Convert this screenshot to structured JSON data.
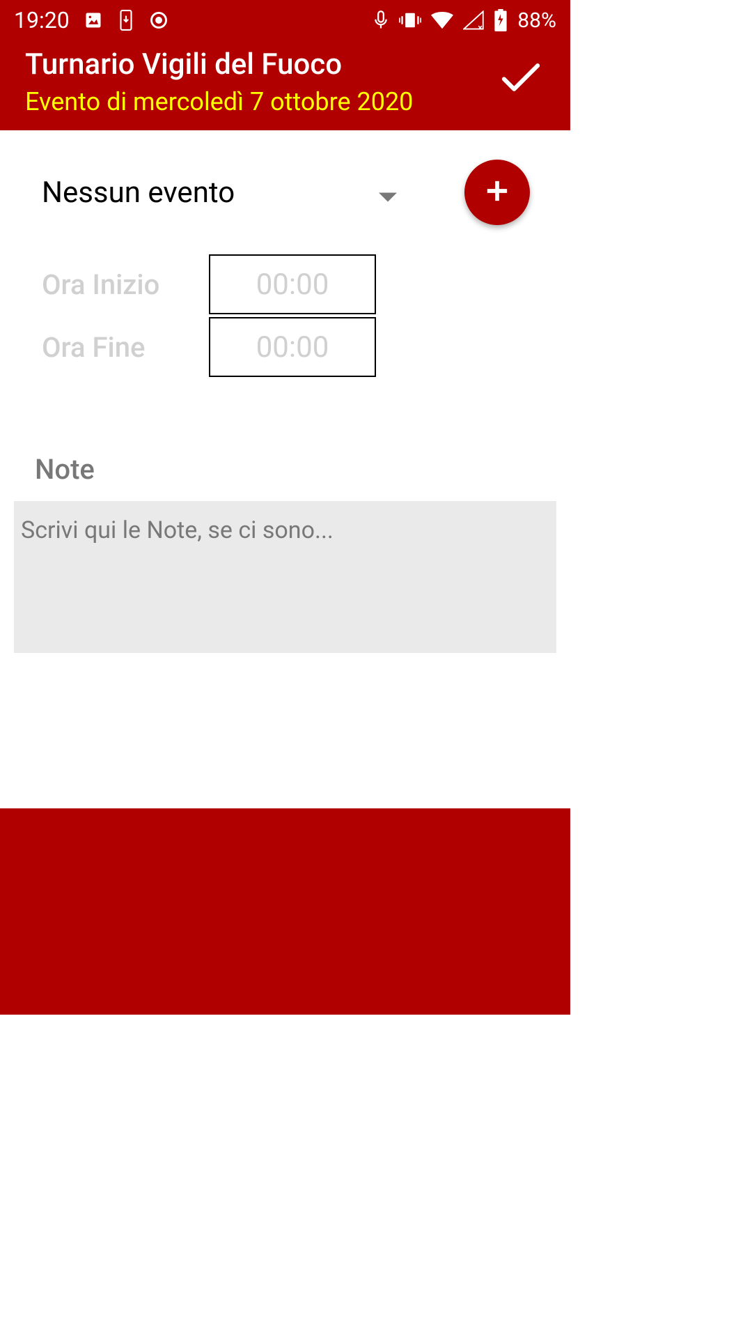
{
  "status_bar": {
    "time": "19:20",
    "battery": "88%",
    "icons": {
      "photo": "photo-icon",
      "download": "download-icon",
      "target": "target-icon",
      "mic": "mic-icon",
      "vibrate": "vibrate-icon",
      "wifi": "wifi-icon",
      "signal": "signal-icon",
      "battery_icon": "battery-icon"
    }
  },
  "header": {
    "title": "Turnario Vigili del Fuoco",
    "subtitle": "Evento di mercoledì 7 ottobre 2020",
    "confirm_icon": "check-icon"
  },
  "main": {
    "event_dropdown": {
      "selected": "Nessun evento"
    },
    "add_button_icon": "plus-icon",
    "start_time": {
      "label": "Ora Inizio",
      "value": "00:00"
    },
    "end_time": {
      "label": "Ora Fine",
      "value": "00:00"
    },
    "notes": {
      "label": "Note",
      "placeholder": "Scrivi qui le Note, se ci sono..."
    }
  },
  "nav": {
    "recent_icon": "square-icon",
    "home_icon": "circle-icon",
    "back_icon": "back-triangle-icon"
  }
}
